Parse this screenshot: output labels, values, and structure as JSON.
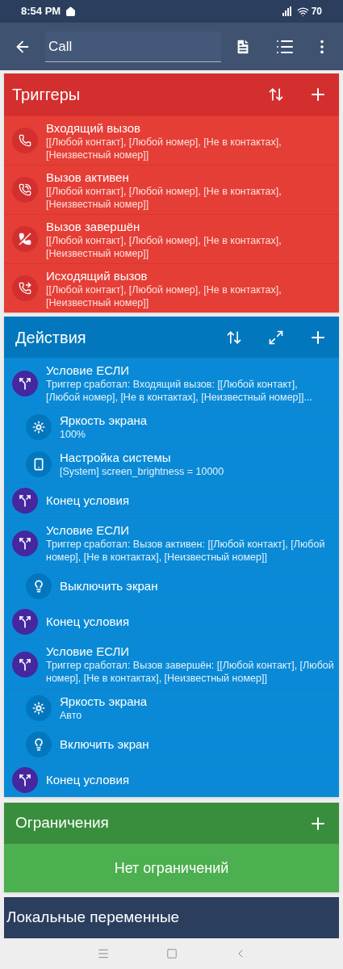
{
  "status_bar": {
    "time": "8:54 PM",
    "battery": "70"
  },
  "toolbar": {
    "name_field": {
      "value": "Call"
    }
  },
  "triggers": {
    "title": "Триггеры",
    "items": [
      {
        "kind": "incoming",
        "title": "Входящий вызов",
        "detail": "[[Любой контакт], [Любой номер], [Не в контактах], [Неизвестный номер]]"
      },
      {
        "kind": "active",
        "title": "Вызов активен",
        "detail": "[[Любой контакт], [Любой номер], [Не в контактах], [Неизвестный номер]]"
      },
      {
        "kind": "ended",
        "title": "Вызов завершён",
        "detail": "[[Любой контакт], [Любой номер], [Не в контактах], [Неизвестный номер]]"
      },
      {
        "kind": "outgoing",
        "title": "Исходящий вызов",
        "detail": "[[Любой контакт], [Любой номер], [Не в контактах], [Неизвестный номер]]"
      }
    ]
  },
  "actions": {
    "title": "Действия",
    "items": [
      {
        "kind": "if",
        "title": "Условие ЕСЛИ",
        "detail": "Триггер сработал: Входящий вызов: [[Любой контакт], [Любой номер], [Не в контактах], [Неизвестный номер]]..."
      },
      {
        "kind": "brightness",
        "title": "Яркость экрана",
        "detail": "100%"
      },
      {
        "kind": "system_setting",
        "title": "Настройка системы",
        "detail": "[System] screen_brightness = 10000"
      },
      {
        "kind": "end_if",
        "title": "Конец условия"
      },
      {
        "kind": "if",
        "title": "Условие ЕСЛИ",
        "detail": "Триггер сработал: Вызов активен: [[Любой контакт], [Любой номер], [Не в контактах], [Неизвестный номер]]"
      },
      {
        "kind": "screen_off",
        "title": "Выключить экран"
      },
      {
        "kind": "end_if",
        "title": "Конец условия"
      },
      {
        "kind": "if",
        "title": "Условие ЕСЛИ",
        "detail": "Триггер сработал: Вызов завершён: [[Любой контакт], [Любой номер], [Не в контактах], [Неизвестный номер]]"
      },
      {
        "kind": "brightness",
        "title": "Яркость экрана",
        "detail": "Авто"
      },
      {
        "kind": "screen_on",
        "title": "Включить экран"
      },
      {
        "kind": "end_if",
        "title": "Конец условия"
      }
    ]
  },
  "constraints": {
    "title": "Ограничения",
    "empty_text": "Нет ограничений"
  },
  "local_variables": {
    "title": "Локальные переменные"
  }
}
